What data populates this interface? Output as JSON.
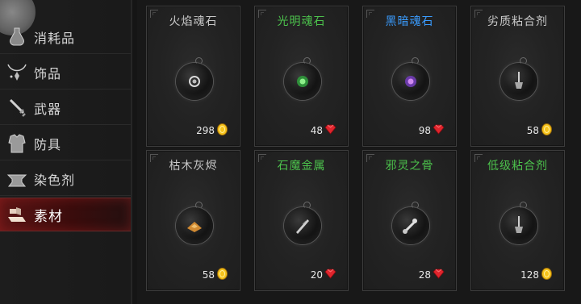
{
  "sidebar": {
    "items": [
      {
        "label": "消耗品",
        "icon": "potion-icon",
        "active": false
      },
      {
        "label": "饰品",
        "icon": "necklace-icon",
        "active": false
      },
      {
        "label": "武器",
        "icon": "sword-icon",
        "active": false
      },
      {
        "label": "防具",
        "icon": "armor-icon",
        "active": false
      },
      {
        "label": "染色剂",
        "icon": "anvil-icon",
        "active": false
      },
      {
        "label": "素材",
        "icon": "material-icon",
        "active": true
      }
    ]
  },
  "colors": {
    "name_white": "#c8c8c8",
    "name_green": "#4cc24c",
    "name_blue": "#3a9cff",
    "gold": "#f5c21b",
    "ruby": "#e0252d",
    "active_bg": "#5a1414"
  },
  "items": [
    {
      "name": "火焰魂石",
      "name_color": "white",
      "price": "298",
      "currency": "gold-coin-icon",
      "icon": "fire-soulstone-icon"
    },
    {
      "name": "光明魂石",
      "name_color": "green",
      "price": "48",
      "currency": "ruby-icon",
      "icon": "light-soulstone-icon"
    },
    {
      "name": "黑暗魂石",
      "name_color": "blue",
      "price": "98",
      "currency": "ruby-icon",
      "icon": "dark-soulstone-icon"
    },
    {
      "name": "劣质粘合剂",
      "name_color": "white",
      "price": "58",
      "currency": "gold-coin-icon",
      "icon": "shovel-icon"
    },
    {
      "name": "枯木灰烬",
      "name_color": "white",
      "price": "58",
      "currency": "gold-coin-icon",
      "icon": "ash-icon"
    },
    {
      "name": "石魔金属",
      "name_color": "green",
      "price": "20",
      "currency": "ruby-icon",
      "icon": "metal-shard-icon"
    },
    {
      "name": "邪灵之骨",
      "name_color": "green",
      "price": "28",
      "currency": "ruby-icon",
      "icon": "bone-icon"
    },
    {
      "name": "低级粘合剂",
      "name_color": "green",
      "price": "128",
      "currency": "gold-coin-icon",
      "icon": "shovel-icon"
    }
  ]
}
